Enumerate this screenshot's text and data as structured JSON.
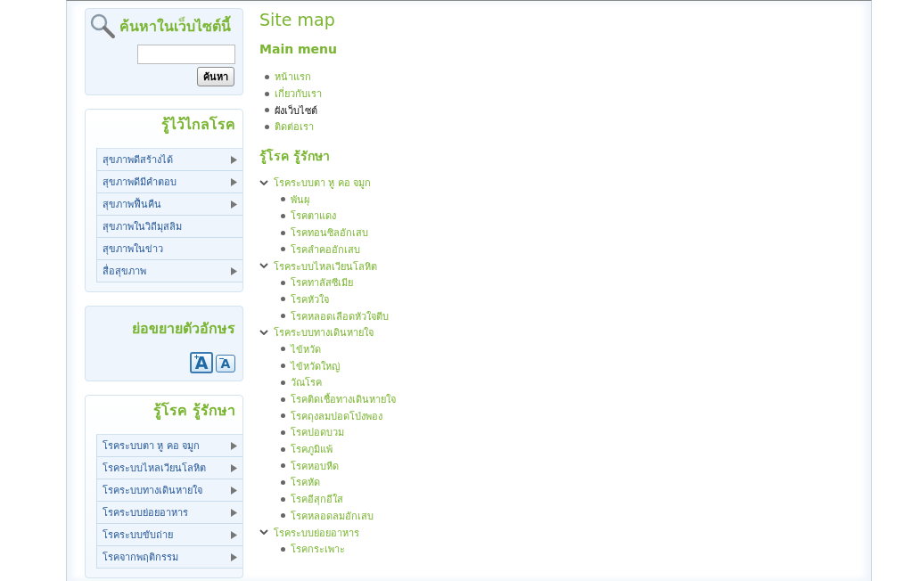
{
  "search_block": {
    "title": "ค้นหาในเว็บไซต์นี้",
    "button": "ค้นหา"
  },
  "health_menu": {
    "title": "รู้ไว้ไกลโรค",
    "items": [
      {
        "label": "สุขภาพดีสร้างได้",
        "has_submenu": true
      },
      {
        "label": "สุขภาพดีมีคำตอบ",
        "has_submenu": true
      },
      {
        "label": "สุขภาพฟื้นคืน",
        "has_submenu": true
      },
      {
        "label": "สุขภาพในวิถีมุสลิม",
        "has_submenu": false
      },
      {
        "label": "สุขภาพในข่าว",
        "has_submenu": false
      },
      {
        "label": "สื่อสุขภาพ",
        "has_submenu": true
      }
    ]
  },
  "font_size_block": {
    "title": "ย่อขยายตัวอักษร",
    "buttons": [
      {
        "kind": "increase",
        "label": "A"
      },
      {
        "kind": "decrease",
        "label": "A"
      }
    ]
  },
  "disease_menu": {
    "title": "รู้โรค รู้รักษา",
    "items": [
      {
        "label": "โรคระบบตา หู คอ จมูก",
        "has_submenu": true
      },
      {
        "label": "โรคระบบไหลเวียนโลหิต",
        "has_submenu": true
      },
      {
        "label": "โรคระบบทางเดินหายใจ",
        "has_submenu": true
      },
      {
        "label": "โรคระบบย่อยอาหาร",
        "has_submenu": true
      },
      {
        "label": "โรคระบบขับถ่าย",
        "has_submenu": true
      },
      {
        "label": "โรคจากพฤติกรรม",
        "has_submenu": true
      }
    ]
  },
  "page_title": "Site map",
  "main_menu": {
    "title": "Main menu",
    "items": [
      {
        "label": "หน้าแรก",
        "selected": false
      },
      {
        "label": "เกี่ยวกับเรา",
        "selected": false
      },
      {
        "label": "ผังเว็บไซต์",
        "selected": true
      },
      {
        "label": "ติดต่อเรา",
        "selected": false
      }
    ]
  },
  "disease_tree": {
    "title": "รู้โรค รู้รักษา",
    "items": [
      {
        "label": "โรคระบบตา หู คอ จมูก",
        "expanded": true,
        "children": [
          {
            "label": "พันผุ"
          },
          {
            "label": "โรคตาแดง"
          },
          {
            "label": "โรคทอนซิลอักเสบ"
          },
          {
            "label": "โรคลำคออักเสบ"
          }
        ]
      },
      {
        "label": "โรคระบบไหลเวียนโลหิต",
        "expanded": true,
        "children": [
          {
            "label": "โรคทาลัสซีเมีย"
          },
          {
            "label": "โรคหัวใจ"
          },
          {
            "label": "โรคหลอดเลือดหัวใจตีบ"
          }
        ]
      },
      {
        "label": "โรคระบบทางเดินหายใจ",
        "expanded": true,
        "children": [
          {
            "label": "ไข้หวัด"
          },
          {
            "label": "ไข้หวัดใหญ่"
          },
          {
            "label": "วัณโรค"
          },
          {
            "label": "โรคติดเชื้อทางเดินหายใจ"
          },
          {
            "label": "โรคถุงลมปอดโป่งพอง"
          },
          {
            "label": "โรคปอดบวม"
          },
          {
            "label": "โรคภูมิแพ้"
          },
          {
            "label": "โรคหอบหืด"
          },
          {
            "label": "โรคหัด"
          },
          {
            "label": "โรคอีสุกอีใส"
          },
          {
            "label": "โรคหลอดลมอักเสบ"
          }
        ]
      },
      {
        "label": "โรคระบบย่อยอาหาร",
        "expanded": true,
        "children": [
          {
            "label": "โรคกระเพาะ"
          }
        ]
      }
    ]
  }
}
